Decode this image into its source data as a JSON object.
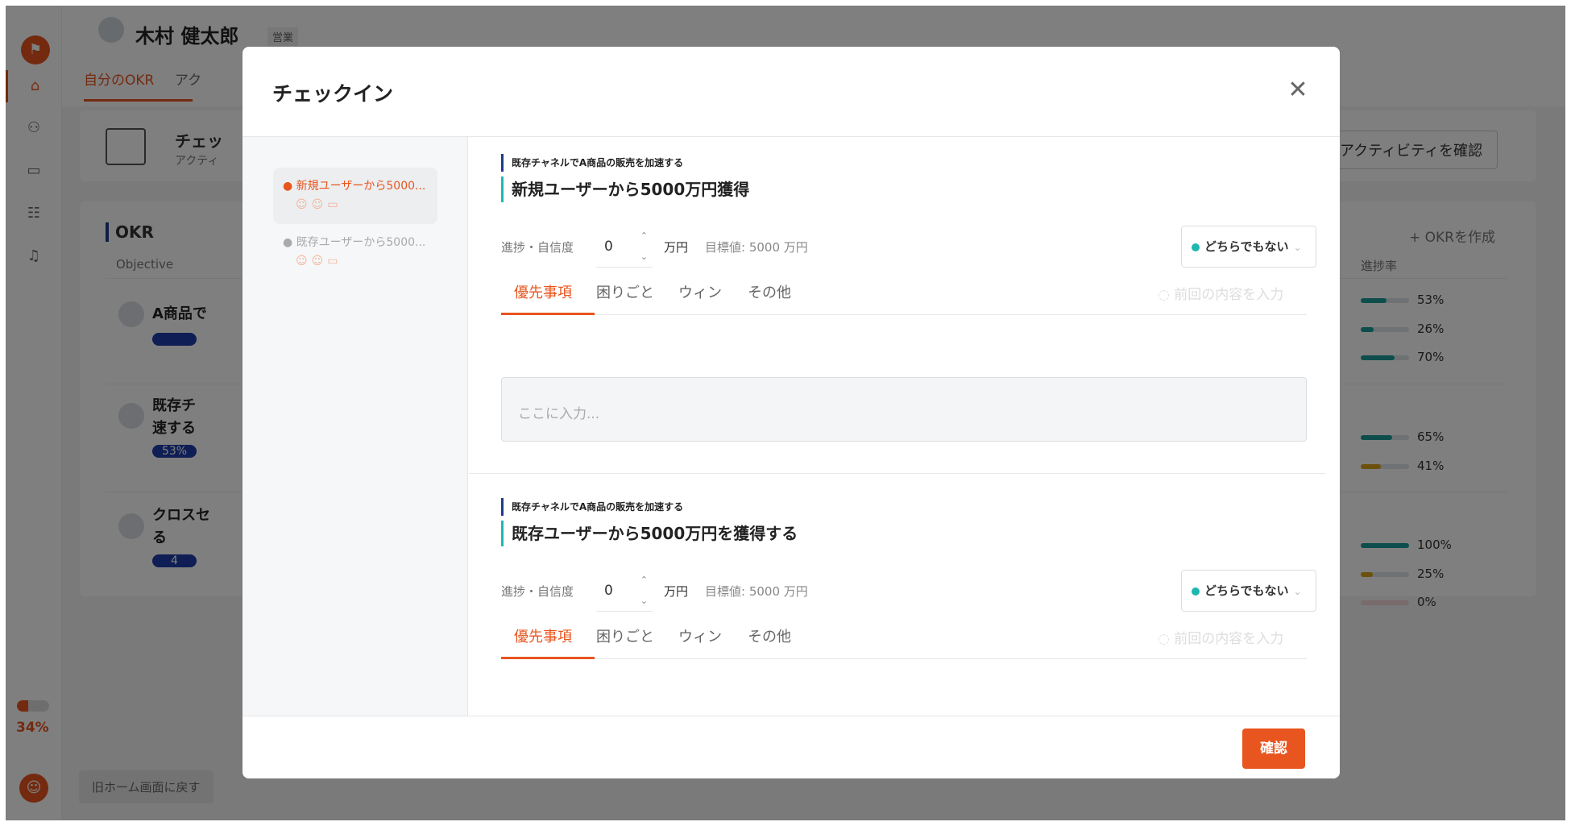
{
  "header": {
    "user_name": "木村 健太郎",
    "role_badge": "営業",
    "tabs": [
      "自分のOKR",
      "アク"
    ]
  },
  "background": {
    "checkin_card": {
      "title": "チェッ",
      "sub": "アクティ",
      "button": "アクティビティを確認"
    },
    "okr_label": "OKR",
    "create_okr": "+ OKRを作成",
    "col_objective": "Objective",
    "col_progress": "進捗率",
    "rows": [
      {
        "title_line1": "A商品で",
        "title_line2": "",
        "badge": "",
        "pcts": [
          "53%",
          "26%",
          "70%"
        ]
      },
      {
        "title_line1": "既存チ",
        "title_line2": "速する",
        "badge": "53%",
        "pcts": [
          "65%",
          "41%"
        ]
      },
      {
        "title_line1": "クロスセ",
        "title_line2": "る",
        "badge": "4",
        "pcts": [
          "100%",
          "25%",
          "0%"
        ]
      }
    ],
    "sidebar_progress": "34%",
    "back_button": "旧ホーム画面に戻す"
  },
  "modal": {
    "title": "チェックイン",
    "close": "✕",
    "side_items": [
      {
        "label": "新規ユーザーから5000...",
        "active": true
      },
      {
        "label": "既存ユーザーから5000...",
        "active": false
      }
    ],
    "krs": [
      {
        "objective": "既存チャネルでA商品の販売を加速する",
        "key_result": "新規ユーザーから5000万円獲得",
        "progress_label": "進捗・自信度",
        "value": "0",
        "unit": "万円",
        "target": "目標値: 5000 万円",
        "confidence": "どちらでもない",
        "tabs": [
          "優先事項",
          "困りごと",
          "ウィン",
          "その他"
        ],
        "prev_content": "前回の内容を入力",
        "placeholder": "ここに入力..."
      },
      {
        "objective": "既存チャネルでA商品の販売を加速する",
        "key_result": "既存ユーザーから5000万円を獲得する",
        "progress_label": "進捗・自信度",
        "value": "0",
        "unit": "万円",
        "target": "目標値: 5000 万円",
        "confidence": "どちらでもない",
        "tabs": [
          "優先事項",
          "困りごと",
          "ウィン",
          "その他"
        ],
        "prev_content": "前回の内容を入力"
      }
    ],
    "confirm_button": "確認"
  },
  "colors": {
    "accent": "#e8551e",
    "teal": "#1fb8b0",
    "navy": "#1f3c8a"
  }
}
